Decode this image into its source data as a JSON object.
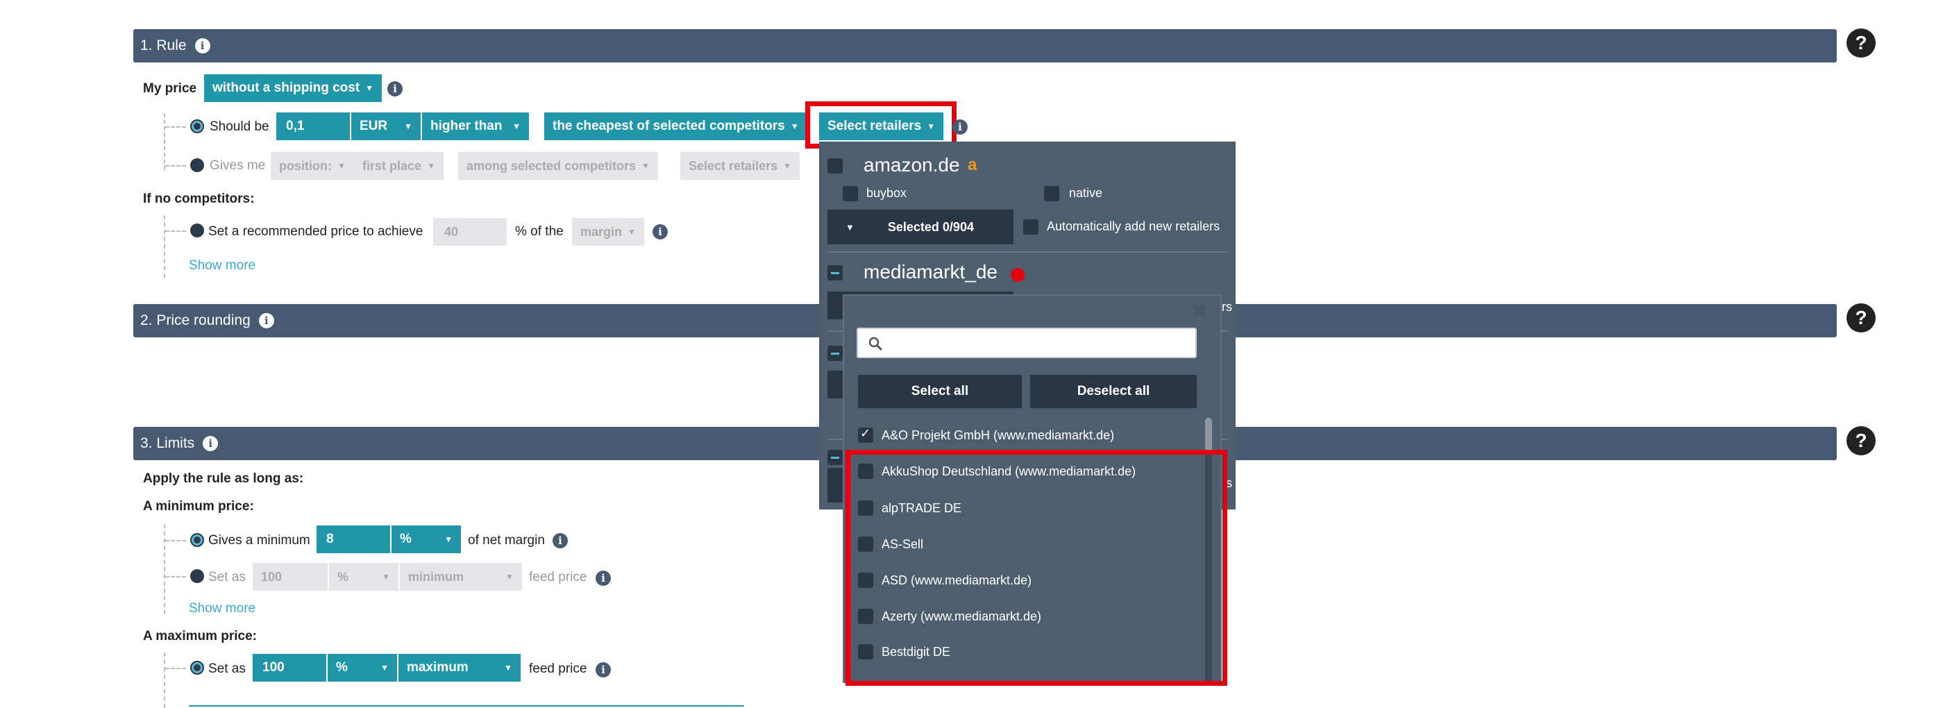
{
  "section1": {
    "title": "1. Rule"
  },
  "section2": {
    "title": "2. Price rounding"
  },
  "section3": {
    "title": "3. Limits"
  },
  "help_label": "?",
  "info_label": "i",
  "rule": {
    "my_price_label": "My price",
    "shipping_dropdown": "without a shipping cost",
    "should_be_label": "Should be",
    "amount_value": "0,1",
    "currency_dropdown": "EUR",
    "comparison_dropdown": "higher than",
    "competitor_dropdown": "the cheapest of selected competitors",
    "select_retailers_button": "Select retailers",
    "gives_me_label": "Gives me",
    "position_dropdown": "position:",
    "place_dropdown": "first place",
    "among_dropdown": "among selected competitors",
    "select_retailers_disabled": "Select retailers",
    "if_no_competitors_label": "If no competitors:",
    "recommended_label": "Set a recommended price to achieve",
    "recommended_value": "40",
    "percent_of_label": "% of the",
    "margin_dropdown": "margin",
    "show_more_1": "Show more"
  },
  "limits": {
    "apply_label": "Apply the rule as long as:",
    "min_price_label": "A minimum price:",
    "gives_minimum_label": "Gives a minimum",
    "min_value": "8",
    "min_unit": "%",
    "net_margin_label": "of net margin",
    "set_as_label": "Set as",
    "set_as_value": "100",
    "set_as_unit": "%",
    "minimum_dropdown": "minimum",
    "feed_price_label": "feed price",
    "show_more_2": "Show more",
    "max_price_label": "A maximum price:",
    "max_set_as_label": "Set as",
    "max_value": "100",
    "max_unit": "%",
    "maximum_dropdown": "maximum",
    "max_feed_price_label": "feed price"
  },
  "retailer_panel": {
    "amazon_name": "amazon.de",
    "buybox_label": "buybox",
    "native_label": "native",
    "selected_button": "Selected 0/904",
    "auto_add_label": "Automatically add new retailers",
    "mediamarkt_name": "mediamarkt_de",
    "partial_text_1": "ers",
    "partial_text_2": "ers"
  },
  "retailer_popup": {
    "close_label": "✖",
    "search_placeholder": "",
    "select_all_button": "Select all",
    "deselect_all_button": "Deselect all",
    "items": [
      "A&O Projekt GmbH (www.mediamarkt.de)",
      "AkkuShop Deutschland (www.mediamarkt.de)",
      "alpTRADE DE",
      "AS-Sell",
      "ASD (www.mediamarkt.de)",
      "Azerty (www.mediamarkt.de)",
      "Bestdigit DE"
    ],
    "checked_items": [
      true,
      false,
      false,
      false,
      false,
      false,
      false
    ]
  },
  "colors": {
    "header_bg": "#475a72",
    "teal": "#2196a8",
    "panel_bg": "#4f5e6f",
    "highlight_red": "#e3000f"
  }
}
